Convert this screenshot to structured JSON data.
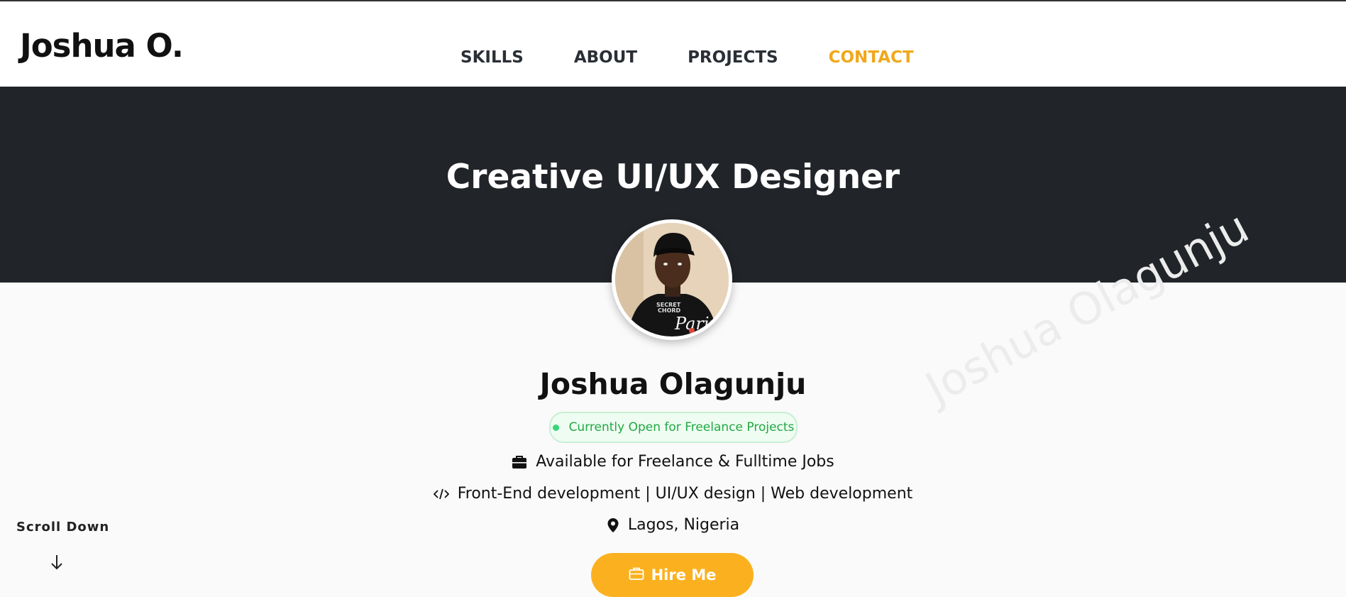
{
  "header": {
    "brand": "Joshua O.",
    "nav": [
      {
        "label": "SKILLS"
      },
      {
        "label": "ABOUT"
      },
      {
        "label": "PROJECTS"
      },
      {
        "label": "CONTACT",
        "active": true
      }
    ]
  },
  "hero": {
    "title": "Creative UI/UX Designer"
  },
  "profile": {
    "name": "Joshua Olagunju",
    "status_badge": "Currently Open for Freelance Projects",
    "availability": "Available for Freelance & Fulltime Jobs",
    "roles": "Front-End development | UI/UX design | Web development",
    "location": "Lagos, Nigeria",
    "hire_button": "Hire Me",
    "watermark": "Joshua Olagunju"
  },
  "scroll": {
    "label": "Scroll Down"
  },
  "icons": {
    "availability": "briefcase-icon",
    "roles": "code-icon",
    "location": "map-pin-icon",
    "hire": "briefcase-outline-icon",
    "scroll": "arrow-down-icon"
  },
  "colors": {
    "accent": "#f0a81c",
    "button": "#fbb11f",
    "hero_bg": "#212428",
    "status_green": "#22a844"
  }
}
